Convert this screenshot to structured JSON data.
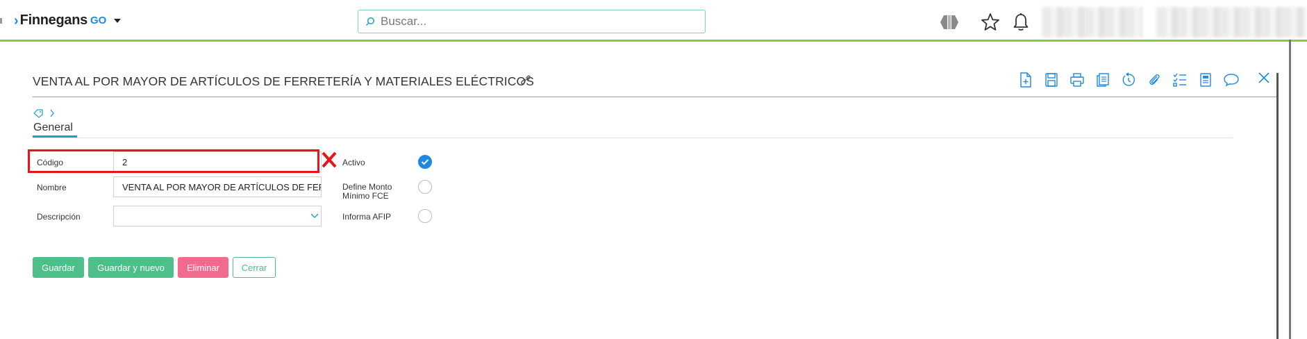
{
  "app": {
    "brand": "Finnegans",
    "brand_suffix": "GO"
  },
  "search": {
    "placeholder": "Buscar..."
  },
  "header": {
    "title": "VENTA AL POR MAYOR DE ARTÍCULOS DE FERRETERÍA Y MATERIALES ELÉCTRICOS"
  },
  "tabs": [
    {
      "label": "General"
    }
  ],
  "form": {
    "codigo_label": "Código",
    "codigo_value": "2",
    "nombre_label": "Nombre",
    "nombre_value": "VENTA AL POR MAYOR DE ARTÍCULOS DE FERRETERÍA Y MATERIALES ELÉCTRICOS",
    "descripcion_label": "Descripción",
    "descripcion_value": "",
    "activo_label": "Activo",
    "activo_checked": true,
    "define_monto_label_1": "Define Monto",
    "define_monto_label_2": "Mínimo FCE",
    "define_monto_checked": false,
    "informa_afip_label": "Informa AFIP",
    "informa_afip_checked": false
  },
  "buttons": {
    "guardar": "Guardar",
    "guardar_nuevo": "Guardar y nuevo",
    "eliminar": "Eliminar",
    "cerrar": "Cerrar"
  },
  "toolbar": [
    "new-document-icon",
    "save-icon",
    "print-icon",
    "copy-icon",
    "refresh-icon",
    "attach-icon",
    "checklist-icon",
    "report-icon",
    "comment-icon"
  ],
  "colors": {
    "accent_green": "#4dbf8a",
    "danger_pink": "#f26b8e",
    "brand_blue": "#1e88e5",
    "topbar_line": "#8dc63f",
    "highlight_red": "#e8141a"
  }
}
